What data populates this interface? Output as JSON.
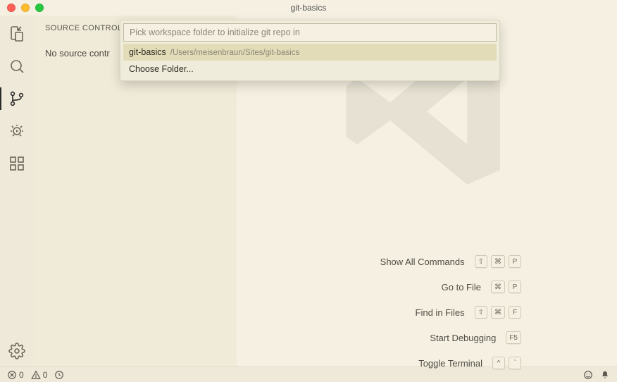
{
  "window": {
    "title": "git-basics"
  },
  "sidebar": {
    "title": "SOURCE CONTROL",
    "message": "No source contr"
  },
  "quickPick": {
    "placeholder": "Pick workspace folder to initialize git repo in",
    "items": [
      {
        "name": "git-basics",
        "path": "/Users/meisenbraun/Sites/git-basics"
      },
      {
        "name": "Choose Folder...",
        "path": ""
      }
    ]
  },
  "shortcuts": {
    "rows": [
      {
        "label": "Show All Commands",
        "keys": [
          "⇧",
          "⌘",
          "P"
        ]
      },
      {
        "label": "Go to File",
        "keys": [
          "⌘",
          "P"
        ]
      },
      {
        "label": "Find in Files",
        "keys": [
          "⇧",
          "⌘",
          "F"
        ]
      },
      {
        "label": "Start Debugging",
        "keys": [
          "F5"
        ]
      },
      {
        "label": "Toggle Terminal",
        "keys": [
          "^",
          "`"
        ]
      }
    ]
  },
  "status": {
    "errors": "0",
    "warnings": "0"
  }
}
